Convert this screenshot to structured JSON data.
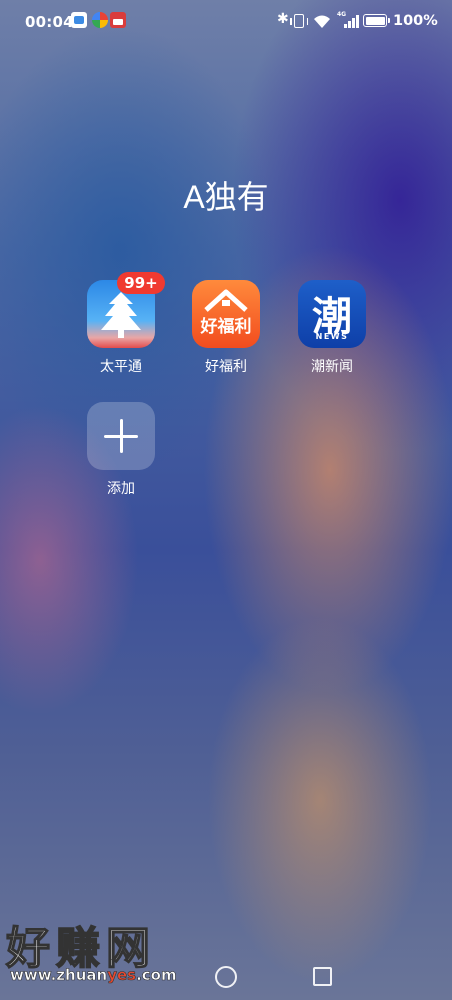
{
  "status_bar": {
    "time": "00:04",
    "notification_icons": [
      "app-notification-icon",
      "colorful-app-icon",
      "calendar-app-icon"
    ],
    "system_icons": [
      "bluetooth-icon",
      "vibrate-icon",
      "wifi-icon",
      "cellular-signal-icon",
      "battery-icon"
    ],
    "network_label": "4G",
    "battery": "100%"
  },
  "folder": {
    "title": "A独有",
    "apps": [
      {
        "label": "太平通",
        "badge": "99+",
        "icon": "taipingtong-icon",
        "color": "#2c88e6"
      },
      {
        "label": "好福利",
        "icon_text": "好福利",
        "icon": "haofuli-icon",
        "color": "#f24c1e"
      },
      {
        "label": "潮新闻",
        "icon_text": "潮",
        "icon_sub": "NEWS",
        "icon": "chaoxinwen-icon",
        "color": "#1e5fc9"
      }
    ],
    "add": {
      "label": "添加",
      "icon": "plus-icon"
    }
  },
  "watermark": {
    "main": "好赚网",
    "url_prefix": "www.zhuan",
    "url_highlight": "yes",
    "url_suffix": ".com"
  },
  "nav_bar": {
    "buttons": [
      "home-button",
      "recents-button"
    ]
  }
}
